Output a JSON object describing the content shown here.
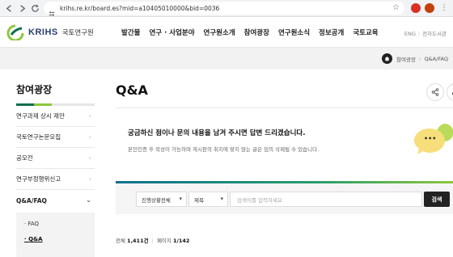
{
  "browser": {
    "url": "krihs.re.kr/board.es?mid=a10405010000&bid=0036"
  },
  "header": {
    "logo_text": "KRIHS",
    "logo_kr": "국토연구원",
    "nav": [
      "발간물",
      "연구 · 사업분야",
      "연구원소개",
      "참여광장",
      "연구원소식",
      "정보공개",
      "국토교육"
    ],
    "util": [
      "ENG",
      "전자도서관"
    ]
  },
  "breadcrumb": {
    "items": [
      "참여광장",
      "Q&A/FAQ"
    ]
  },
  "sidebar": {
    "title": "참여광장",
    "items": [
      {
        "label": "연구과제 상시 제안"
      },
      {
        "label": "국토연구논문모집"
      },
      {
        "label": "공모전"
      },
      {
        "label": "연구부정행위신고"
      },
      {
        "label": "Q&A/FAQ"
      }
    ],
    "sub_items": [
      "FAQ",
      "Q&A"
    ]
  },
  "main": {
    "title": "Q&A",
    "notice_heading": "궁금하신 점이나 문의 내용을 남겨 주시면 답변 드리겠습니다.",
    "notice_text": "본인인증 후 작성이 가능하며 게시판의 취지에 맞지 않는 글은 임의 삭제될 수 있습니다.",
    "bubble_dots": "•••"
  },
  "search": {
    "status_select": "진행상황전체",
    "field_select": "제목",
    "placeholder": "검색어를 입력하세요",
    "button": "검색"
  },
  "listing": {
    "total_label": "전체",
    "total_count": "1,411건",
    "page_label": "페이지",
    "page_value": "1/142"
  },
  "colors": {
    "brand_green": "#0e6e4e",
    "brand_lime": "#8dc63f",
    "brand_navy": "#2a3f6b",
    "bubble_yellow": "#f6de7a",
    "bubble_green": "#b9db5a"
  }
}
